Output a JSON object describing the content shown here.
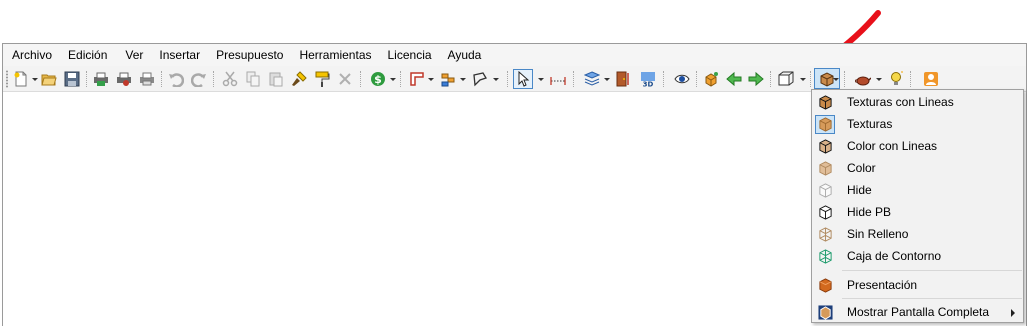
{
  "menubar": {
    "items": [
      "Archivo",
      "Edición",
      "Ver",
      "Insertar",
      "Presupuesto",
      "Herramientas",
      "Licencia",
      "Ayuda"
    ]
  },
  "toolbar": {
    "icons": [
      "new-document-icon",
      "open-folder-icon",
      "save-icon",
      "print-icon",
      "print-preview-icon",
      "printer-icon",
      "undo-icon",
      "redo-icon",
      "cut-icon",
      "copy-icon",
      "paste-icon",
      "format-brush-icon",
      "paint-roller-icon",
      "delete-icon",
      "budget-icon",
      "wall-icon",
      "stairs-icon",
      "polygon-icon",
      "select-arrow-icon",
      "measure-icon",
      "layers-icon",
      "door-icon",
      "view-3d-icon",
      "eye-icon",
      "box-move-icon",
      "arrow-left-icon",
      "arrow-right-icon",
      "perspective-icon",
      "render-mode-icon",
      "teapot-icon",
      "light-icon",
      "user-icon"
    ],
    "three_d_label": "3D"
  },
  "dropdown": {
    "items": [
      {
        "label": "Texturas con Lineas",
        "icon": "textured-lines-cube-icon",
        "selected": false
      },
      {
        "label": "Texturas",
        "icon": "textured-cube-icon",
        "selected": true
      },
      {
        "label": "Color con Lineas",
        "icon": "color-lines-cube-icon",
        "selected": false
      },
      {
        "label": "Color",
        "icon": "color-cube-icon",
        "selected": false
      },
      {
        "label": "Hide",
        "icon": "hide-cube-icon",
        "selected": false
      },
      {
        "label": "Hide PB",
        "icon": "hide-pb-cube-icon",
        "selected": false
      },
      {
        "label": "Sin Relleno",
        "icon": "wireframe-cube-icon",
        "selected": false
      },
      {
        "label": "Caja de Contorno",
        "icon": "bounding-box-icon",
        "selected": false
      },
      {
        "label": "Presentación",
        "icon": "presentation-cube-icon",
        "selected": false
      },
      {
        "label": "Mostrar Pantalla Completa",
        "icon": "fullscreen-cube-icon",
        "selected": false,
        "submenu": true
      }
    ]
  },
  "colors": {
    "accent": "#4a88c7",
    "annotation_arrow": "#e8101a",
    "menu_background": "#f2f2f2"
  }
}
